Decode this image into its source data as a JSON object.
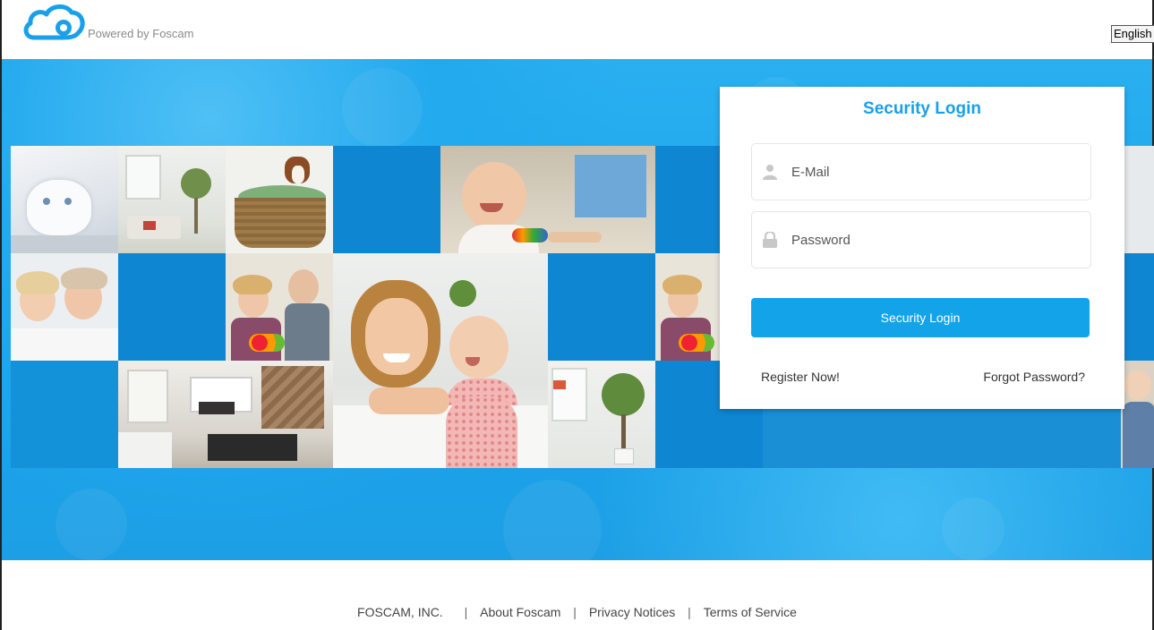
{
  "header": {
    "logo_icon": "cloud-icon",
    "powered_text": "Powered by Foscam",
    "language": "English"
  },
  "login": {
    "title": "Security Login",
    "email_placeholder": "E-Mail",
    "password_placeholder": "Password",
    "submit_label": "Security Login",
    "register_label": "Register Now!",
    "forgot_label": "Forgot Password?"
  },
  "footer": {
    "company": "FOSCAM, INC.",
    "links": [
      "About Foscam",
      "Privacy Notices",
      "Terms of Service"
    ],
    "separator": "|"
  },
  "colors": {
    "accent": "#1aa0e8",
    "banner_blue": "#1ea7ee",
    "tile_blue": "#0f86d1"
  },
  "photos": [
    {
      "name": "kitten-photo"
    },
    {
      "name": "living-room-photo"
    },
    {
      "name": "dog-basket-photo"
    },
    {
      "name": "baby-photo"
    },
    {
      "name": "grandmother-girl-photo"
    },
    {
      "name": "elderly-couple-photo"
    },
    {
      "name": "mother-baby-photo"
    },
    {
      "name": "interior-photo"
    },
    {
      "name": "room-plant-photo"
    }
  ]
}
